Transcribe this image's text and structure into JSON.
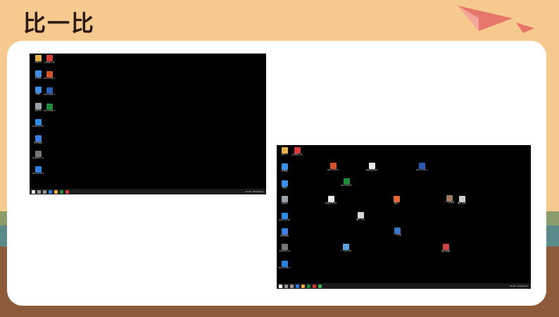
{
  "slide": {
    "title": "比一比"
  },
  "colors": {
    "background": "#f6c98e",
    "card": "#ffffff",
    "desktop": "#000000",
    "plane": "#e8776b"
  },
  "left_screen": {
    "icons": [
      {
        "label": "admin",
        "icon": "folder-icon",
        "color": "#e8b24a"
      },
      {
        "label": "此电脑",
        "icon": "computer-icon",
        "color": "#3d8ee6"
      },
      {
        "label": "网络",
        "icon": "network-icon",
        "color": "#3d8ee6"
      },
      {
        "label": "回收站",
        "icon": "recycle-bin-icon",
        "color": "#9aa3ad"
      },
      {
        "label": "Internet Explorer",
        "icon": "ie-icon",
        "color": "#2e8be6"
      },
      {
        "label": "控制面板",
        "icon": "control-panel-icon",
        "color": "#3d7ee6"
      },
      {
        "label": "desktop.ini",
        "icon": "file-icon",
        "color": "#777777"
      },
      {
        "label": "Microsoft Edge",
        "icon": "edge-icon",
        "color": "#2f7fe0"
      },
      {
        "label": "五笔输入法",
        "icon": "app-icon",
        "color": "#d93a3a"
      },
      {
        "label": "Microsoft PowerPoint",
        "icon": "powerpoint-icon",
        "color": "#d2542c"
      },
      {
        "label": "Microsoft Word 2010",
        "icon": "word-icon",
        "color": "#2b5eb8"
      },
      {
        "label": "Microsoft Excel 2010",
        "icon": "excel-icon",
        "color": "#1f8a3a"
      }
    ],
    "taskbar": {
      "time": "15:04",
      "date": "2020/4/21"
    }
  },
  "right_screen": {
    "icons": [
      {
        "label": "admin",
        "icon": "folder-icon",
        "color": "#e8b24a"
      },
      {
        "label": "此电脑",
        "icon": "computer-icon",
        "color": "#3d8ee6"
      },
      {
        "label": "网络",
        "icon": "network-icon",
        "color": "#3d8ee6"
      },
      {
        "label": "回收站",
        "icon": "recycle-bin-icon",
        "color": "#9aa3ad"
      },
      {
        "label": "Internet Explorer",
        "icon": "ie-icon",
        "color": "#2e8be6"
      },
      {
        "label": "控制面板",
        "icon": "control-panel-icon",
        "color": "#3d7ee6"
      },
      {
        "label": "desktop.ini",
        "icon": "file-icon",
        "color": "#777777"
      },
      {
        "label": "Microsoft Edge",
        "icon": "edge-icon",
        "color": "#2f7fe0"
      },
      {
        "label": "五笔输入法",
        "icon": "app-icon",
        "color": "#d93a3a"
      },
      {
        "label": "Microsoft PowerPoint",
        "icon": "powerpoint-icon",
        "color": "#d2542c"
      },
      {
        "label": "Microsoft Word 2010",
        "icon": "word-icon",
        "color": "#2b5eb8"
      },
      {
        "label": "Microsoft Excel 2010",
        "icon": "excel-icon",
        "color": "#1f8a3a"
      },
      {
        "label": "新建文本文档",
        "icon": "text-file-icon",
        "color": "#e8e8e8"
      },
      {
        "label": "图片",
        "icon": "image-icon",
        "color": "#e06a3a"
      },
      {
        "label": "图片.jpg",
        "icon": "image-file-icon",
        "color": "#d9d9d9"
      },
      {
        "label": "一个文档",
        "icon": "document-icon",
        "color": "#3a74c9"
      },
      {
        "label": "一个word文档",
        "icon": "word-doc-icon",
        "color": "#5fa0e0"
      },
      {
        "label": "图片截图",
        "icon": "screenshot-icon",
        "color": "#c44"
      },
      {
        "label": "一个文件夹",
        "icon": "folder-icon",
        "color": "#a07860"
      },
      {
        "label": "新建文本文档 2",
        "icon": "text-file-icon",
        "color": "#e8e8e8"
      },
      {
        "label": "图片文件",
        "icon": "image-file-icon",
        "color": "#ccc"
      }
    ],
    "taskbar": {
      "time": "15:04",
      "date": "2020/4/21"
    }
  }
}
